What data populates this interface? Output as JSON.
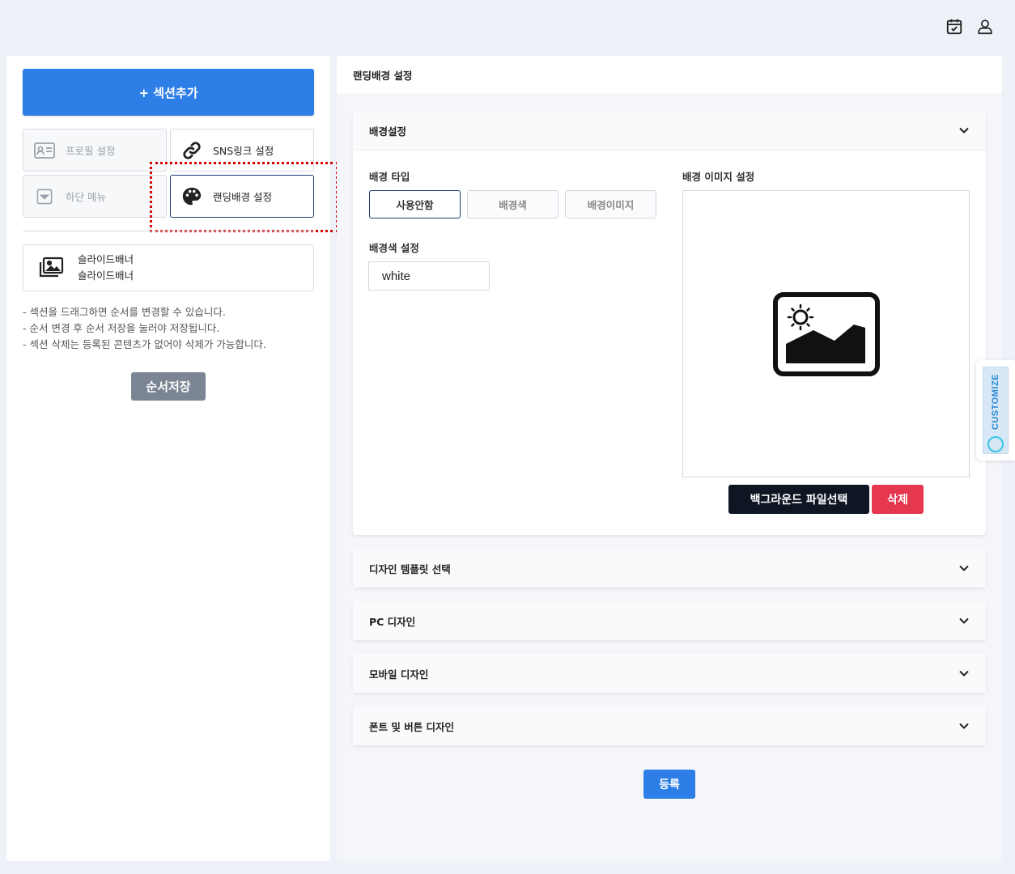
{
  "topbar": {
    "icons": [
      "calendar-check-icon",
      "user-icon"
    ]
  },
  "left_panel": {
    "add_section_label": "+ 섹션추가",
    "tiles": [
      {
        "label": "프로필 설정",
        "icon": "profile-card-icon",
        "state": "disabled"
      },
      {
        "label": "SNS링크 설정",
        "icon": "link-icon",
        "state": "normal"
      },
      {
        "label": "하단 메뉴",
        "icon": "dropdown-box-icon",
        "state": "disabled"
      },
      {
        "label": "랜딩배경 설정",
        "icon": "palette-icon",
        "state": "active"
      }
    ],
    "slide_banner": {
      "line1": "슬라이드배너",
      "line2": "슬라이드배너",
      "icon": "images-icon"
    },
    "notes": [
      "- 섹션을 드래그하면 순서를 변경할 수 있습니다.",
      "- 순서 변경 후 순서 저장을 눌러야 저장됩니다.",
      "- 섹션 삭제는 등록된 콘텐츠가 없어야 삭제가 가능합니다."
    ],
    "save_order_label": "순서저장"
  },
  "right_panel": {
    "title": "랜딩배경 설정",
    "bg_section": {
      "header": "배경설정",
      "bg_type_label": "배경 타입",
      "bg_type_options": [
        "사용안함",
        "배경색",
        "배경이미지"
      ],
      "bg_type_selected": "사용안함",
      "bg_color_label": "배경색 설정",
      "bg_color_value": "white",
      "bg_image_label": "배경 이미지 설정",
      "file_select_label": "백그라운드 파일선택",
      "delete_label": "삭제"
    },
    "collapsed_sections": [
      "디자인 템플릿 선택",
      "PC 디자인",
      "모바일 디자인",
      "폰트 및 버튼 디자인"
    ],
    "register_label": "등록"
  },
  "customize_tab": {
    "label": "CUSTOMIZE"
  },
  "colors": {
    "primary": "#2d7ee6",
    "dark_button": "#0e1624",
    "danger": "#e5374e",
    "gray_button": "#7b8594",
    "highlight": "#d40000"
  }
}
